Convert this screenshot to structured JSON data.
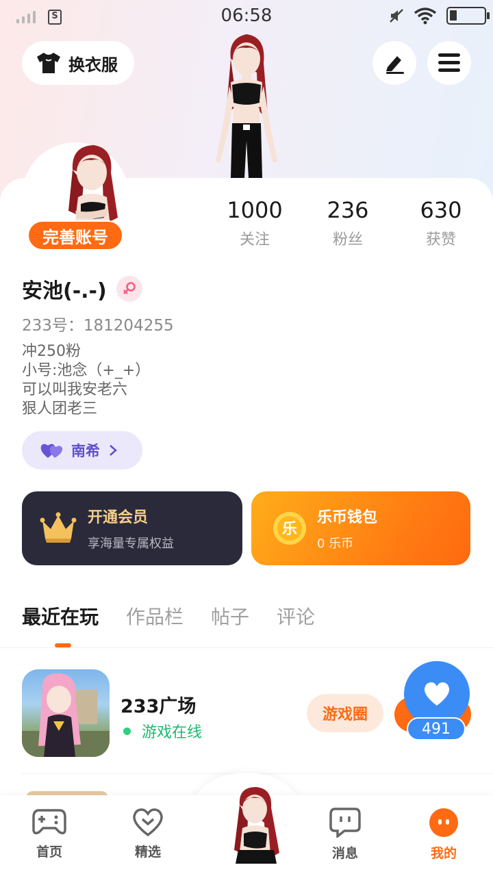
{
  "status_bar": {
    "time": "06:58"
  },
  "header": {
    "dress_button_label": "换衣服",
    "edit_icon": "pen-icon",
    "menu_icon": "hamburger-icon"
  },
  "profile": {
    "complete_account_label": "完善账号",
    "stats": [
      {
        "value": "1000",
        "label": "关注"
      },
      {
        "value": "236",
        "label": "粉丝"
      },
      {
        "value": "630",
        "label": "获赞"
      }
    ],
    "username": "安池(-.-)",
    "uid": "233号：181204255",
    "bio_lines": [
      "冲250粉",
      "小号:池念（+_+）",
      "可以叫我安老六",
      "狠人团老三"
    ],
    "tag_label": "南希"
  },
  "cards": {
    "vip_title": "开通会员",
    "vip_subtitle": "享海量专属权益",
    "wallet_title": "乐币钱包",
    "wallet_subtitle": "0 乐币",
    "wallet_coin_glyph": "乐"
  },
  "tabs": [
    "最近在玩",
    "作品栏",
    "帖子",
    "评论"
  ],
  "recent_game": {
    "title": "233广场",
    "status": "游戏在线",
    "circle_button": "游戏圈",
    "like_count": "491"
  },
  "bottom_nav": [
    {
      "label": "首页",
      "icon": "gamepad-icon"
    },
    {
      "label": "精选",
      "icon": "heart-badge-icon"
    },
    {
      "label": "",
      "icon": "avatar-center"
    },
    {
      "label": "消息",
      "icon": "chat-icon"
    },
    {
      "label": "我的",
      "icon": "profile-face-icon"
    }
  ],
  "colors": {
    "accent": "#ff6a12",
    "vip_bg": "#2a2a3a",
    "online_green": "#1eb870",
    "like_blue": "#3c8cf6"
  }
}
